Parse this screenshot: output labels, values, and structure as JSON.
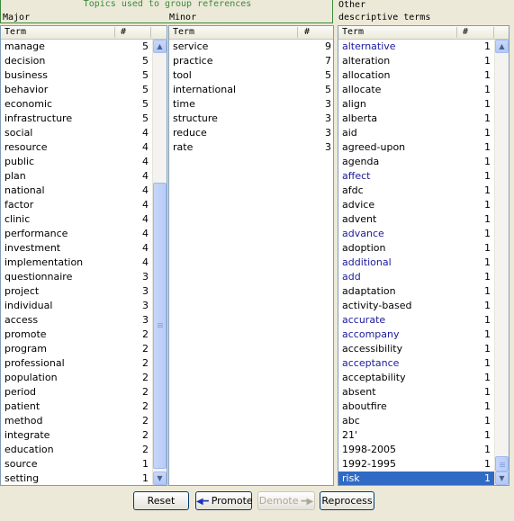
{
  "header": {
    "topics_title": "Topics used to group references",
    "major_label": "Major",
    "minor_label": "Minor",
    "other_label_line1": "Other",
    "other_label_line2": "descriptive terms"
  },
  "major": {
    "col_term": "Term",
    "col_count": "#",
    "rows": [
      {
        "term": "manage",
        "count": "5"
      },
      {
        "term": "decision",
        "count": "5"
      },
      {
        "term": "business",
        "count": "5"
      },
      {
        "term": "behavior",
        "count": "5"
      },
      {
        "term": "economic",
        "count": "5"
      },
      {
        "term": "infrastructure",
        "count": "5"
      },
      {
        "term": "social",
        "count": "4"
      },
      {
        "term": "resource",
        "count": "4"
      },
      {
        "term": "public",
        "count": "4"
      },
      {
        "term": "plan",
        "count": "4"
      },
      {
        "term": "national",
        "count": "4"
      },
      {
        "term": "factor",
        "count": "4"
      },
      {
        "term": "clinic",
        "count": "4"
      },
      {
        "term": "performance",
        "count": "4"
      },
      {
        "term": "investment",
        "count": "4"
      },
      {
        "term": "implementation",
        "count": "4"
      },
      {
        "term": "questionnaire",
        "count": "3"
      },
      {
        "term": "project",
        "count": "3"
      },
      {
        "term": "individual",
        "count": "3"
      },
      {
        "term": "access",
        "count": "3"
      },
      {
        "term": "promote",
        "count": "2"
      },
      {
        "term": "program",
        "count": "2"
      },
      {
        "term": "professional",
        "count": "2"
      },
      {
        "term": "population",
        "count": "2"
      },
      {
        "term": "period",
        "count": "2"
      },
      {
        "term": "patient",
        "count": "2"
      },
      {
        "term": "method",
        "count": "2"
      },
      {
        "term": "integrate",
        "count": "2"
      },
      {
        "term": "education",
        "count": "2"
      },
      {
        "term": "source",
        "count": "1"
      },
      {
        "term": "setting",
        "count": "1"
      }
    ]
  },
  "minor": {
    "col_term": "Term",
    "col_count": "#",
    "rows": [
      {
        "term": "service",
        "count": "9"
      },
      {
        "term": "practice",
        "count": "7"
      },
      {
        "term": "tool",
        "count": "5"
      },
      {
        "term": "international",
        "count": "5"
      },
      {
        "term": "time",
        "count": "3"
      },
      {
        "term": "structure",
        "count": "3"
      },
      {
        "term": "reduce",
        "count": "3"
      },
      {
        "term": "rate",
        "count": "3"
      }
    ]
  },
  "other": {
    "col_term": "Term",
    "col_count": "#",
    "rows": [
      {
        "term": "alternative",
        "count": "1",
        "link": true
      },
      {
        "term": "alteration",
        "count": "1"
      },
      {
        "term": "allocation",
        "count": "1"
      },
      {
        "term": "allocate",
        "count": "1"
      },
      {
        "term": "align",
        "count": "1"
      },
      {
        "term": "alberta",
        "count": "1"
      },
      {
        "term": "aid",
        "count": "1"
      },
      {
        "term": "agreed-upon",
        "count": "1"
      },
      {
        "term": "agenda",
        "count": "1"
      },
      {
        "term": "affect",
        "count": "1",
        "link": true
      },
      {
        "term": "afdc",
        "count": "1"
      },
      {
        "term": "advice",
        "count": "1"
      },
      {
        "term": "advent",
        "count": "1"
      },
      {
        "term": "advance",
        "count": "1",
        "link": true
      },
      {
        "term": "adoption",
        "count": "1"
      },
      {
        "term": "additional",
        "count": "1",
        "link": true
      },
      {
        "term": "add",
        "count": "1",
        "link": true
      },
      {
        "term": "adaptation",
        "count": "1"
      },
      {
        "term": "activity-based",
        "count": "1"
      },
      {
        "term": "accurate",
        "count": "1",
        "link": true
      },
      {
        "term": "accompany",
        "count": "1",
        "link": true
      },
      {
        "term": "accessibility",
        "count": "1"
      },
      {
        "term": "acceptance",
        "count": "1",
        "link": true
      },
      {
        "term": "acceptability",
        "count": "1"
      },
      {
        "term": "absent",
        "count": "1"
      },
      {
        "term": "aboutfire",
        "count": "1"
      },
      {
        "term": "abc",
        "count": "1"
      },
      {
        "term": "21'",
        "count": "1"
      },
      {
        "term": "1998-2005",
        "count": "1"
      },
      {
        "term": "1992-1995",
        "count": "1"
      },
      {
        "term": "risk",
        "count": "1",
        "selected": true
      }
    ]
  },
  "buttons": {
    "reset": "Reset",
    "promote": "Promote",
    "demote": "Demote",
    "reprocess": "Reprocess"
  },
  "colors": {
    "link": "#1a1a9a",
    "selection": "#316ac5",
    "topics_border": "#3a8a3a"
  }
}
